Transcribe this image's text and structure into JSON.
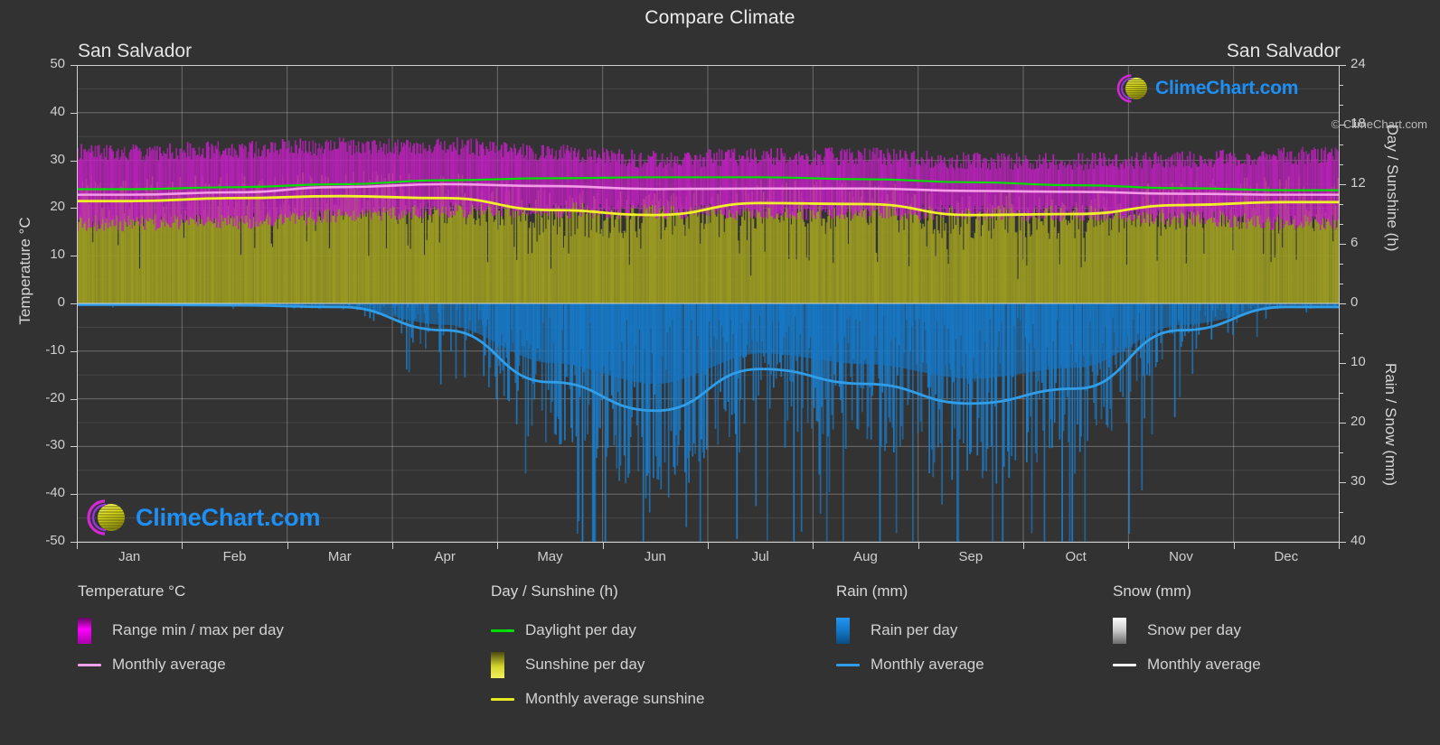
{
  "header": {
    "title": "Compare Climate",
    "location_left": "San Salvador",
    "location_right": "San Salvador"
  },
  "branding": {
    "logo_text": "ClimeChart.com",
    "copyright": "© ClimeChart.com",
    "logo_arc_color": "#d328d3",
    "logo_sphere_color": "#d8d828",
    "logo_text_color": "#1e90f5"
  },
  "axes": {
    "left_title": "Temperature °C",
    "right_title_top": "Day / Sunshine (h)",
    "right_title_bottom": "Rain / Snow (mm)",
    "left_ticks": [
      "50",
      "40",
      "30",
      "20",
      "10",
      "0",
      "-10",
      "-20",
      "-30",
      "-40",
      "-50"
    ],
    "right_ticks_day": [
      "24",
      "18",
      "12",
      "6",
      "0"
    ],
    "right_ticks_rain": [
      "0",
      "10",
      "20",
      "30",
      "40"
    ],
    "x_ticks": [
      "Jan",
      "Feb",
      "Mar",
      "Apr",
      "May",
      "Jun",
      "Jul",
      "Aug",
      "Sep",
      "Oct",
      "Nov",
      "Dec"
    ]
  },
  "legend": {
    "columns": [
      {
        "heading": "Temperature °C",
        "items": [
          {
            "label": "Range min / max per day",
            "style": "box",
            "color": "#e609e6"
          },
          {
            "label": "Monthly average",
            "style": "line",
            "color": "#f0a0e8"
          }
        ]
      },
      {
        "heading": "Day / Sunshine (h)",
        "items": [
          {
            "label": "Daylight per day",
            "style": "line",
            "color": "#00e000"
          },
          {
            "label": "Sunshine per day",
            "style": "box",
            "color": "#e8e83c"
          },
          {
            "label": "Monthly average sunshine",
            "style": "line",
            "color": "#e8e820"
          }
        ]
      },
      {
        "heading": "Rain (mm)",
        "items": [
          {
            "label": "Rain per day",
            "style": "box",
            "color": "#1a8fe0"
          },
          {
            "label": "Monthly average",
            "style": "line",
            "color": "#2f9de8"
          }
        ]
      },
      {
        "heading": "Snow (mm)",
        "items": [
          {
            "label": "Snow per day",
            "style": "box",
            "color": "#f0f0f0"
          },
          {
            "label": "Monthly average",
            "style": "line",
            "color": "#f0f0f0"
          }
        ]
      }
    ]
  },
  "chart_data": {
    "type": "area",
    "title": "Compare Climate",
    "subtitle": "San Salvador",
    "xlabel": "",
    "ylabel": "Temperature °C",
    "categories": [
      "Jan",
      "Feb",
      "Mar",
      "Apr",
      "May",
      "Jun",
      "Jul",
      "Aug",
      "Sep",
      "Oct",
      "Nov",
      "Dec"
    ],
    "ylim_temperature_c": [
      -50,
      50
    ],
    "ylim_day_sunshine_h": [
      0,
      24
    ],
    "ylim_rain_snow_mm": [
      0,
      40
    ],
    "grid": true,
    "legend_position": "below",
    "series": [
      {
        "name": "Monthly average temperature (°C)",
        "color": "#f0a0e8",
        "axis": "temperature_c",
        "values": [
          22.8,
          23.3,
          24.4,
          25.0,
          24.6,
          24.0,
          24.1,
          24.1,
          23.6,
          23.4,
          23.0,
          22.8
        ]
      },
      {
        "name": "Range max per day (°C)",
        "color": "#e609e6",
        "axis": "temperature_c",
        "values": [
          31.5,
          32.3,
          33.0,
          33.0,
          31.5,
          30.2,
          30.8,
          30.9,
          29.8,
          29.8,
          30.2,
          31.0
        ]
      },
      {
        "name": "Range min per day (°C)",
        "color": "#e609e6",
        "axis": "temperature_c",
        "values": [
          16.8,
          17.2,
          18.3,
          19.5,
          19.6,
          19.3,
          19.2,
          19.2,
          19.0,
          18.8,
          18.0,
          17.0
        ]
      },
      {
        "name": "Daylight per day (h)",
        "color": "#00e000",
        "axis": "day_sunshine_h",
        "values": [
          11.5,
          11.7,
          12.0,
          12.4,
          12.6,
          12.7,
          12.7,
          12.5,
          12.2,
          11.9,
          11.6,
          11.4
        ]
      },
      {
        "name": "Monthly average sunshine (h)",
        "color": "#e8e820",
        "axis": "day_sunshine_h",
        "values": [
          10.3,
          10.6,
          10.8,
          10.6,
          9.4,
          8.9,
          10.1,
          10.0,
          8.9,
          9.0,
          9.9,
          10.2
        ]
      },
      {
        "name": "Monthly average rain (mm)",
        "color": "#2f9de8",
        "axis": "rain_snow_mm",
        "values": [
          0.2,
          0.3,
          0.6,
          4.5,
          13.2,
          18.0,
          11.0,
          13.5,
          16.8,
          14.3,
          4.5,
          0.6
        ]
      },
      {
        "name": "Monthly average snow (mm)",
        "color": "#f0f0f0",
        "axis": "rain_snow_mm",
        "values": [
          0,
          0,
          0,
          0,
          0,
          0,
          0,
          0,
          0,
          0,
          0,
          0
        ]
      }
    ]
  }
}
